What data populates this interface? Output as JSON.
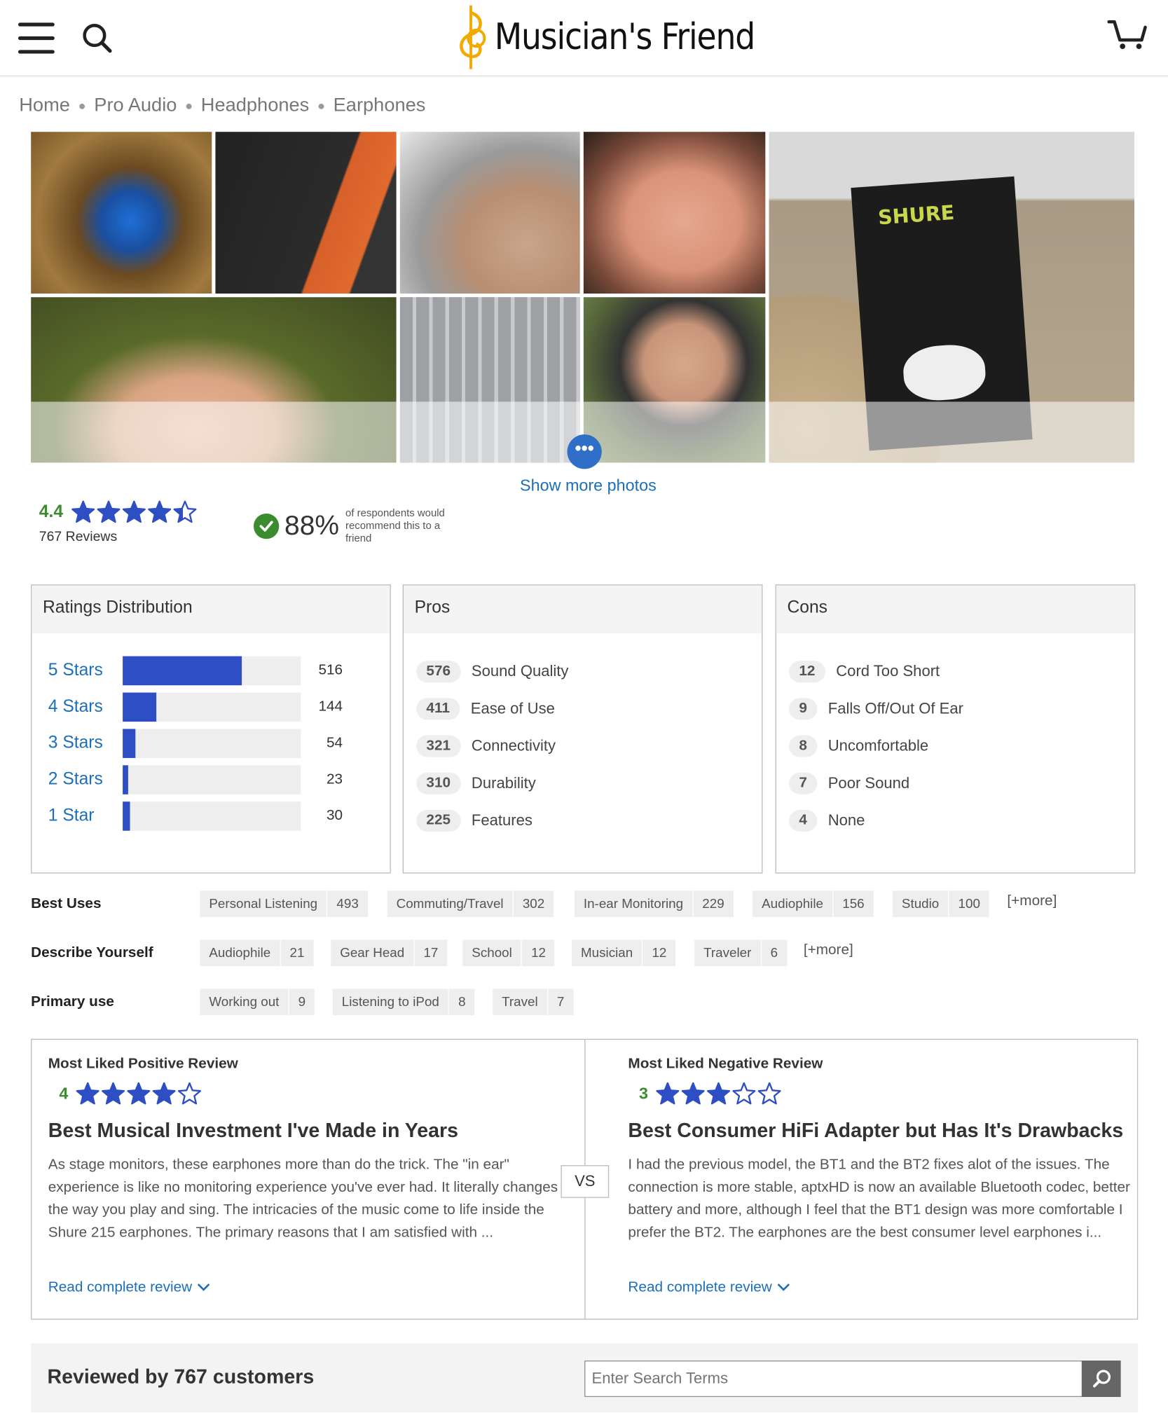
{
  "header": {
    "logo_text": "Musician's Friend"
  },
  "breadcrumb": [
    "Home",
    "Pro Audio",
    "Headphones",
    "Earphones"
  ],
  "photos": {
    "show_more": "Show more photos"
  },
  "summary": {
    "average": "4.4",
    "average_value": 4.4,
    "reviews": "767 Reviews",
    "recommend_pct": "88%",
    "recommend_text": "of respondents would recommend this to a friend"
  },
  "distribution": {
    "title": "Ratings Distribution",
    "rows": [
      {
        "label": "5 Stars",
        "count": "516",
        "value": 516
      },
      {
        "label": "4 Stars",
        "count": "144",
        "value": 144
      },
      {
        "label": "3 Stars",
        "count": "54",
        "value": 54
      },
      {
        "label": "2 Stars",
        "count": "23",
        "value": 23
      },
      {
        "label": "1 Star",
        "count": "30",
        "value": 30
      }
    ]
  },
  "pros": {
    "title": "Pros",
    "items": [
      {
        "count": "576",
        "label": "Sound Quality"
      },
      {
        "count": "411",
        "label": "Ease of Use"
      },
      {
        "count": "321",
        "label": "Connectivity"
      },
      {
        "count": "310",
        "label": "Durability"
      },
      {
        "count": "225",
        "label": "Features"
      }
    ]
  },
  "cons": {
    "title": "Cons",
    "items": [
      {
        "count": "12",
        "label": "Cord Too Short"
      },
      {
        "count": "9",
        "label": "Falls Off/Out Of Ear"
      },
      {
        "count": "8",
        "label": "Uncomfortable"
      },
      {
        "count": "7",
        "label": "Poor Sound"
      },
      {
        "count": "4",
        "label": "None"
      }
    ]
  },
  "tags": {
    "best_uses": {
      "label": "Best Uses",
      "items": [
        {
          "name": "Personal Listening",
          "count": "493"
        },
        {
          "name": "Commuting/Travel",
          "count": "302"
        },
        {
          "name": "In-ear Monitoring",
          "count": "229"
        },
        {
          "name": "Audiophile",
          "count": "156"
        },
        {
          "name": "Studio",
          "count": "100"
        }
      ],
      "more": "[+more]"
    },
    "describe": {
      "label": "Describe Yourself",
      "items": [
        {
          "name": "Audiophile",
          "count": "21"
        },
        {
          "name": "Gear Head",
          "count": "17"
        },
        {
          "name": "School",
          "count": "12"
        },
        {
          "name": "Musician",
          "count": "12"
        },
        {
          "name": "Traveler",
          "count": "6"
        }
      ],
      "more": "[+more]"
    },
    "primary": {
      "label": "Primary use",
      "items": [
        {
          "name": "Working out",
          "count": "9"
        },
        {
          "name": "Listening to iPod",
          "count": "8"
        },
        {
          "name": "Travel",
          "count": "7"
        }
      ]
    }
  },
  "reviews": {
    "vs": "VS",
    "positive": {
      "heading": "Most Liked Positive Review",
      "rating": "4",
      "rating_value": 4,
      "title": "Best Musical Investment I've Made in Years",
      "body": "As stage monitors, these earphones more than do the trick. The \"in ear\" experience is like no monitoring experience you've ever had. It literally changes the way you play and sing. The intricacies of the music come to life inside the Shure 215 earphones. The primary reasons that I am satisfied with ...",
      "read": "Read complete review"
    },
    "negative": {
      "heading": "Most Liked Negative Review",
      "rating": "3",
      "rating_value": 3,
      "title": "Best Consumer HiFi Adapter but Has It's Drawbacks",
      "body": "I had the previous model, the BT1 and the BT2 fixes alot of the issues. The connection is more stable, aptxHD is now an available Bluetooth codec, better battery and more, although I feel that the BT1 design was more comfortable I prefer the BT2. The earphones are the best consumer level earphones i...",
      "read": "Read complete review"
    }
  },
  "footer": {
    "title": "Reviewed by 767 customers",
    "search_placeholder": "Enter Search Terms"
  },
  "colors": {
    "accent": "#1d6fb8",
    "bar": "#2e4fc4",
    "green": "#3b8c2e"
  }
}
